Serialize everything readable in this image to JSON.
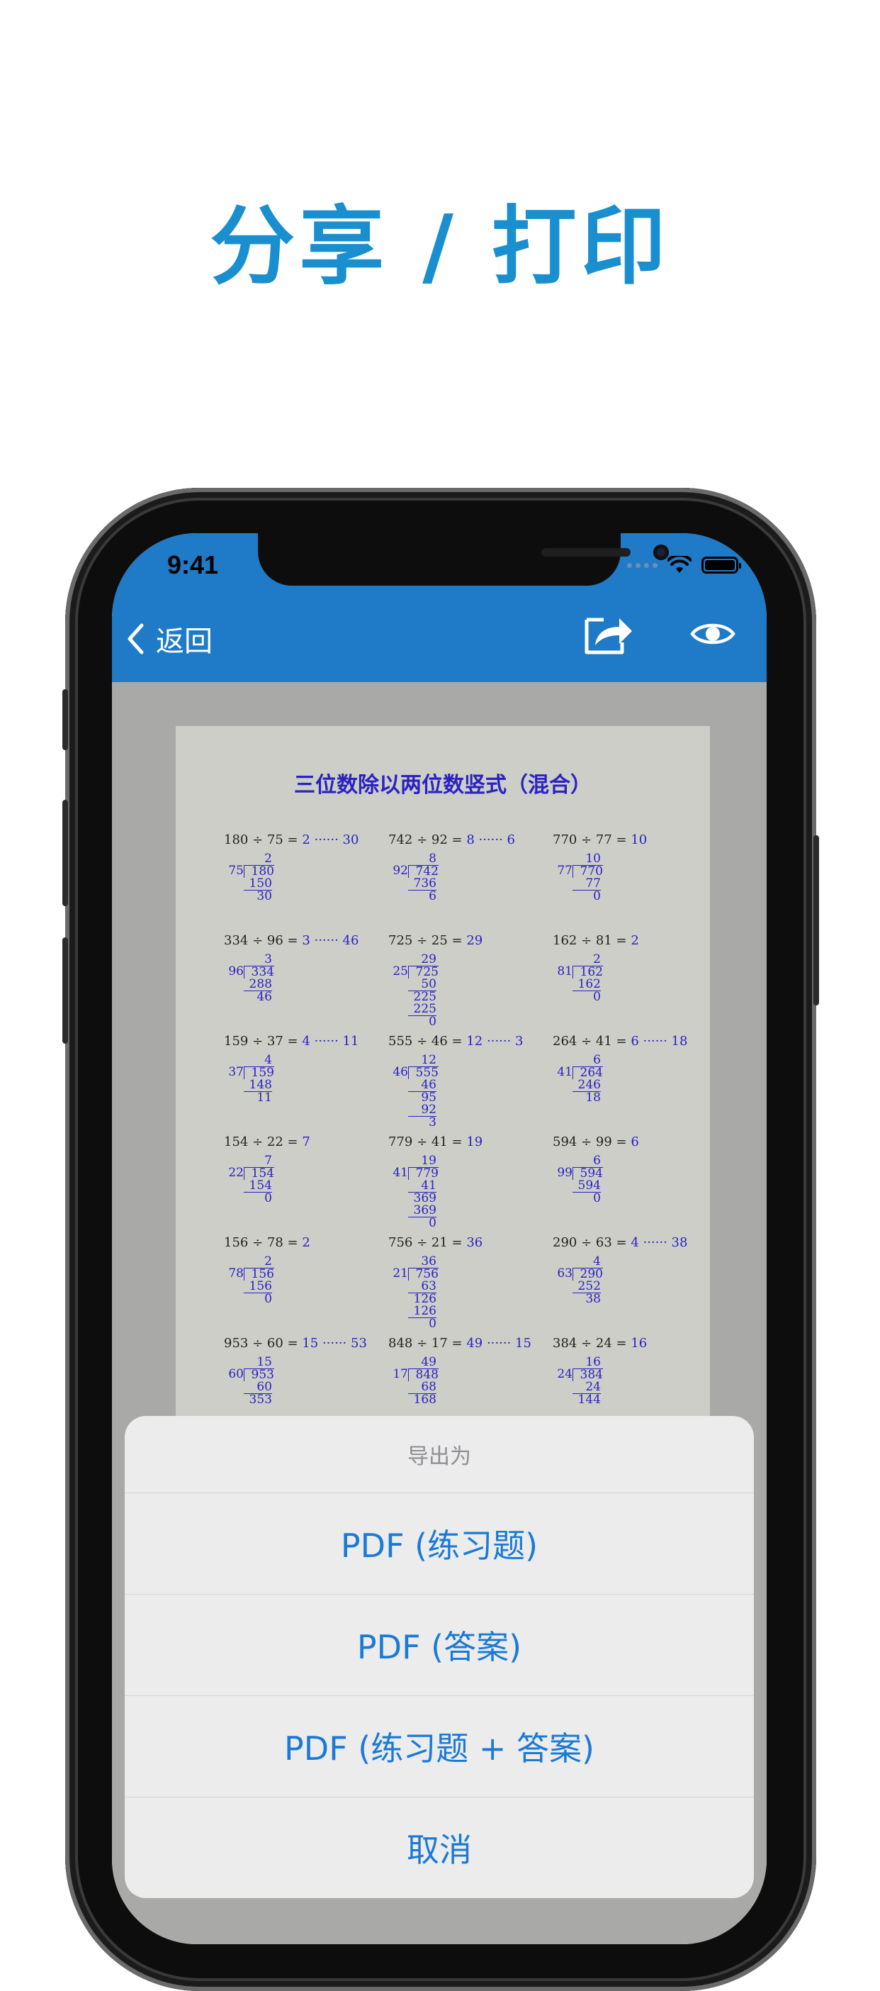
{
  "headline": "分享 / 打印",
  "status_bar": {
    "time": "9:41"
  },
  "navbar": {
    "back_label": "返回",
    "share_icon": "share-icon",
    "preview_icon": "eye-icon"
  },
  "worksheet": {
    "title": "三位数除以两位数竖式（混合）",
    "problems": [
      {
        "dividend": "180",
        "divisor": "75",
        "quotient": "2",
        "remainder": "30",
        "steps": [
          "150",
          "30"
        ]
      },
      {
        "dividend": "742",
        "divisor": "92",
        "quotient": "8",
        "remainder": "6",
        "steps": [
          "736",
          "6"
        ]
      },
      {
        "dividend": "770",
        "divisor": "77",
        "quotient": "10",
        "remainder": "",
        "steps": [
          "77",
          "0"
        ]
      },
      {
        "dividend": "334",
        "divisor": "96",
        "quotient": "3",
        "remainder": "46",
        "steps": [
          "288",
          "46"
        ]
      },
      {
        "dividend": "725",
        "divisor": "25",
        "quotient": "29",
        "remainder": "",
        "steps": [
          "50",
          "225",
          "225",
          "0"
        ]
      },
      {
        "dividend": "162",
        "divisor": "81",
        "quotient": "2",
        "remainder": "",
        "steps": [
          "162",
          "0"
        ]
      },
      {
        "dividend": "159",
        "divisor": "37",
        "quotient": "4",
        "remainder": "11",
        "steps": [
          "148",
          "11"
        ]
      },
      {
        "dividend": "555",
        "divisor": "46",
        "quotient": "12",
        "remainder": "3",
        "steps": [
          "46",
          "95",
          "92",
          "3"
        ]
      },
      {
        "dividend": "264",
        "divisor": "41",
        "quotient": "6",
        "remainder": "18",
        "steps": [
          "246",
          "18"
        ]
      },
      {
        "dividend": "154",
        "divisor": "22",
        "quotient": "7",
        "remainder": "",
        "steps": [
          "154",
          "0"
        ]
      },
      {
        "dividend": "779",
        "divisor": "41",
        "quotient": "19",
        "remainder": "",
        "steps": [
          "41",
          "369",
          "369",
          "0"
        ]
      },
      {
        "dividend": "594",
        "divisor": "99",
        "quotient": "6",
        "remainder": "",
        "steps": [
          "594",
          "0"
        ]
      },
      {
        "dividend": "156",
        "divisor": "78",
        "quotient": "2",
        "remainder": "",
        "steps": [
          "156",
          "0"
        ]
      },
      {
        "dividend": "756",
        "divisor": "21",
        "quotient": "36",
        "remainder": "",
        "steps": [
          "63",
          "126",
          "126",
          "0"
        ]
      },
      {
        "dividend": "290",
        "divisor": "63",
        "quotient": "4",
        "remainder": "38",
        "steps": [
          "252",
          "38"
        ]
      },
      {
        "dividend": "953",
        "divisor": "60",
        "quotient": "15",
        "remainder": "53",
        "steps": [
          "60",
          "353"
        ]
      },
      {
        "dividend": "848",
        "divisor": "17",
        "quotient": "49",
        "remainder": "15",
        "steps": [
          "68",
          "168"
        ]
      },
      {
        "dividend": "384",
        "divisor": "24",
        "quotient": "16",
        "remainder": "",
        "steps": [
          "24",
          "144"
        ]
      }
    ]
  },
  "action_sheet": {
    "title": "导出为",
    "items": [
      "PDF (练习题)",
      "PDF (答案)",
      "PDF (练习题 + 答案)",
      "取消"
    ]
  },
  "colors": {
    "accent": "#1f7ac7",
    "headline": "#1a8fd0",
    "action_text": "#1a7ad6",
    "answer_ink": "#2a22c2"
  }
}
